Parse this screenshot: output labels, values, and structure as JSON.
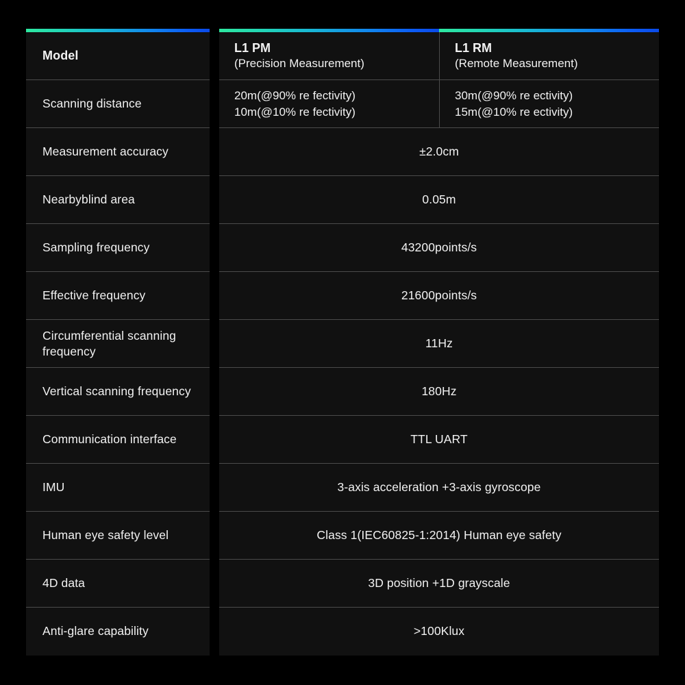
{
  "table": {
    "label_header": "Model",
    "models": [
      {
        "name": "L1 PM",
        "subtitle": "(Precision Measurement)"
      },
      {
        "name": "L1 RM",
        "subtitle": "(Remote Measurement)"
      }
    ],
    "accent_gradient": {
      "from": "#2ee8a0",
      "mid": "#19b9d2",
      "to": "#0b4ae8"
    },
    "colors": {
      "page_background": "#000000",
      "cell_background": "#111111",
      "separator": "#4b4b4b",
      "text": "#f2f2f2"
    },
    "rows": [
      {
        "label": "Scanning distance",
        "split": true,
        "values": [
          [
            "20m(@90% re fectivity)",
            "10m(@10% re fectivity)"
          ],
          [
            "30m(@90% re ectivity)",
            "15m(@10% re ectivity)"
          ]
        ]
      },
      {
        "label": "Measurement accuracy",
        "split": false,
        "value": "±2.0cm"
      },
      {
        "label": "Nearbyblind area",
        "split": false,
        "value": "0.05m"
      },
      {
        "label": "Sampling frequency",
        "split": false,
        "value": "43200points/s"
      },
      {
        "label": "Effective frequency",
        "split": false,
        "value": "21600points/s"
      },
      {
        "label": "Circumferential scanning frequency",
        "split": false,
        "value": "11Hz"
      },
      {
        "label": "Vertical scanning frequency",
        "split": false,
        "value": "180Hz"
      },
      {
        "label": "Communication interface",
        "split": false,
        "value": "TTL UART"
      },
      {
        "label": "IMU",
        "split": false,
        "value": "3-axis acceleration +3-axis gyroscope"
      },
      {
        "label": "Human eye safety level",
        "split": false,
        "value": "Class 1(IEC60825-1:2014) Human eye safety"
      },
      {
        "label": "4D data",
        "split": false,
        "value": "3D position +1D grayscale"
      },
      {
        "label": "Anti-glare capability",
        "split": false,
        "value": ">100Klux"
      }
    ]
  }
}
